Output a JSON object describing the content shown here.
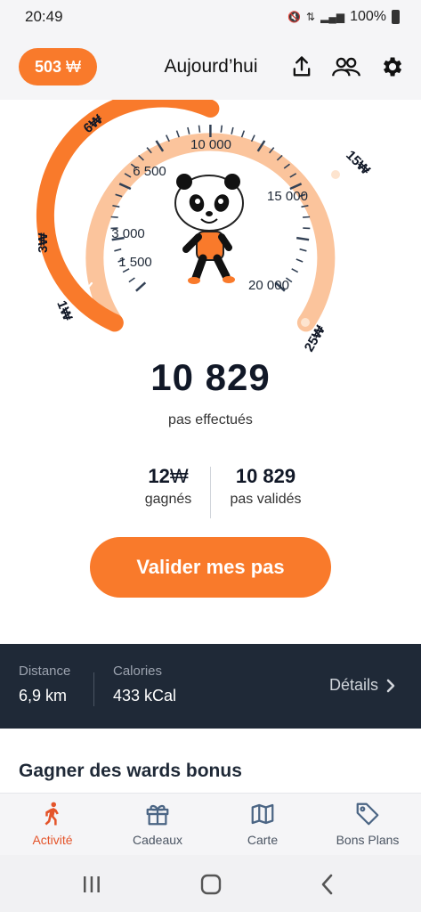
{
  "status_bar": {
    "time": "20:49",
    "battery": "100%"
  },
  "header": {
    "wards_balance": "503",
    "ward_symbol": "₩",
    "title": "Aujourd’hui",
    "icons": [
      "share-icon",
      "friends-icon",
      "gear-icon"
    ]
  },
  "gauge": {
    "current_steps": 10829,
    "max_steps": 25000,
    "scale_labels": [
      "1 500",
      "3 000",
      "6 500",
      "10 000",
      "15 000",
      "20 000"
    ],
    "reward_milestones": [
      {
        "label": "1₩",
        "reached": true
      },
      {
        "label": "3₩",
        "reached": true
      },
      {
        "label": "6₩",
        "reached": true
      },
      {
        "label": "15₩",
        "reached": false
      },
      {
        "label": "25₩",
        "reached": false
      }
    ],
    "colors": {
      "active": "#f97a2b",
      "inactive": "#fbc49c",
      "ticks": "#334155"
    },
    "mascot": "panda-walking"
  },
  "steps": {
    "value": "10 829",
    "label": "pas effectués"
  },
  "stats": {
    "earned_value": "12",
    "earned_symbol": "₩",
    "earned_label": "gagnés",
    "validated_value": "10 829",
    "validated_label": "pas validés"
  },
  "validate_button": "Valider mes pas",
  "summary": {
    "distance_label": "Distance",
    "distance_value": "6,9 km",
    "calories_label": "Calories",
    "calories_value": "433 kCal",
    "details_label": "Détails"
  },
  "bonus_section_title": "Gagner des wards bonus",
  "bottom_nav": [
    {
      "label": "Activité",
      "icon": "walking-icon",
      "active": true
    },
    {
      "label": "Cadeaux",
      "icon": "gift-icon",
      "active": false
    },
    {
      "label": "Carte",
      "icon": "map-icon",
      "active": false
    },
    {
      "label": "Bons Plans",
      "icon": "tag-icon",
      "active": false
    }
  ],
  "colors": {
    "brand_orange": "#f97a2b",
    "dark_panel": "#1f2937",
    "nav_active": "#e4542a"
  }
}
